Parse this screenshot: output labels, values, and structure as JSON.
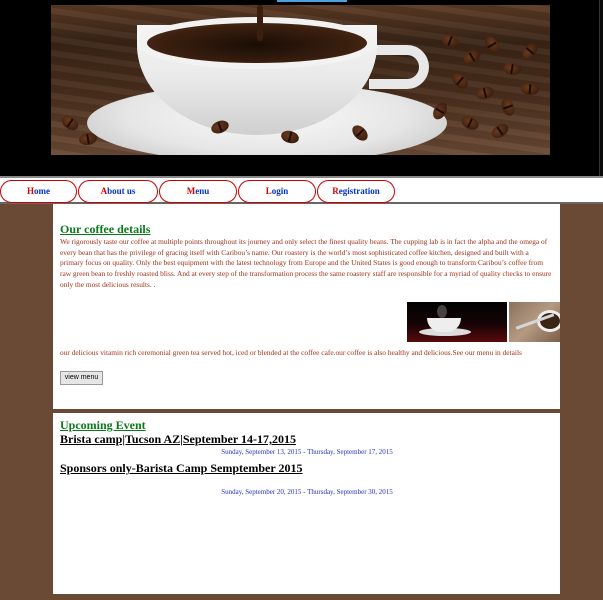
{
  "colors": {
    "page_bg": "#6b4a35",
    "header_bg": "#000000",
    "section_title": "#0a7a1a",
    "body_text": "#a0331a",
    "nav_text": "#0033cc",
    "nav_first_letter": "#dd0000",
    "nav_border": "#cc0000",
    "event_date": "#2233bb"
  },
  "header": {
    "hero_image": "coffee-cup-with-beans-photo"
  },
  "nav": {
    "items": [
      {
        "first": "H",
        "rest": "ome"
      },
      {
        "first": "A",
        "rest": "bout us"
      },
      {
        "first": "M",
        "rest": "enu"
      },
      {
        "first": "L",
        "rest": "ogin"
      },
      {
        "first": "R",
        "rest": "egistration"
      }
    ]
  },
  "coffee": {
    "title": "Our coffee details",
    "description": "We rigorously taste our coffee at multiple points throughout its journey and only select the finest quality beans. The cupping lab is in fact the alpha and the omega of every bean that has the privilege of gracing itself with Caribou’s name. Our roastery is the world’s most sophisticated coffee kitchen, designed and built with a primary focus on quality. Only the best equipment with the latest technology from Europe and the United States is good enough to transform Caribou’s coffee from raw green bean to freshly roasted bliss. And at every step of the transformation process the same roastery staff are responsible for a myriad of quality checks to ensure only the most delicious results. .",
    "menu_text": "our delicious vitamin rich ceremonial green tea served hot, iced or blended at the coffee cafe.our coffee is also healthy and delicious.See our menu in details",
    "view_menu_label": "view menu"
  },
  "events": {
    "title": "Upcoming Event",
    "items": [
      {
        "name": "Brista camp|Tucson AZ|September 14-17,2015",
        "dates": "Sunday, September 13, 2015 - Thursday, September 17, 2015"
      },
      {
        "name": "Sponsors only-Barista Camp Semptember 2015",
        "dates": "Sunday, September 20, 2015 - Thursday, September 30, 2015"
      }
    ]
  }
}
